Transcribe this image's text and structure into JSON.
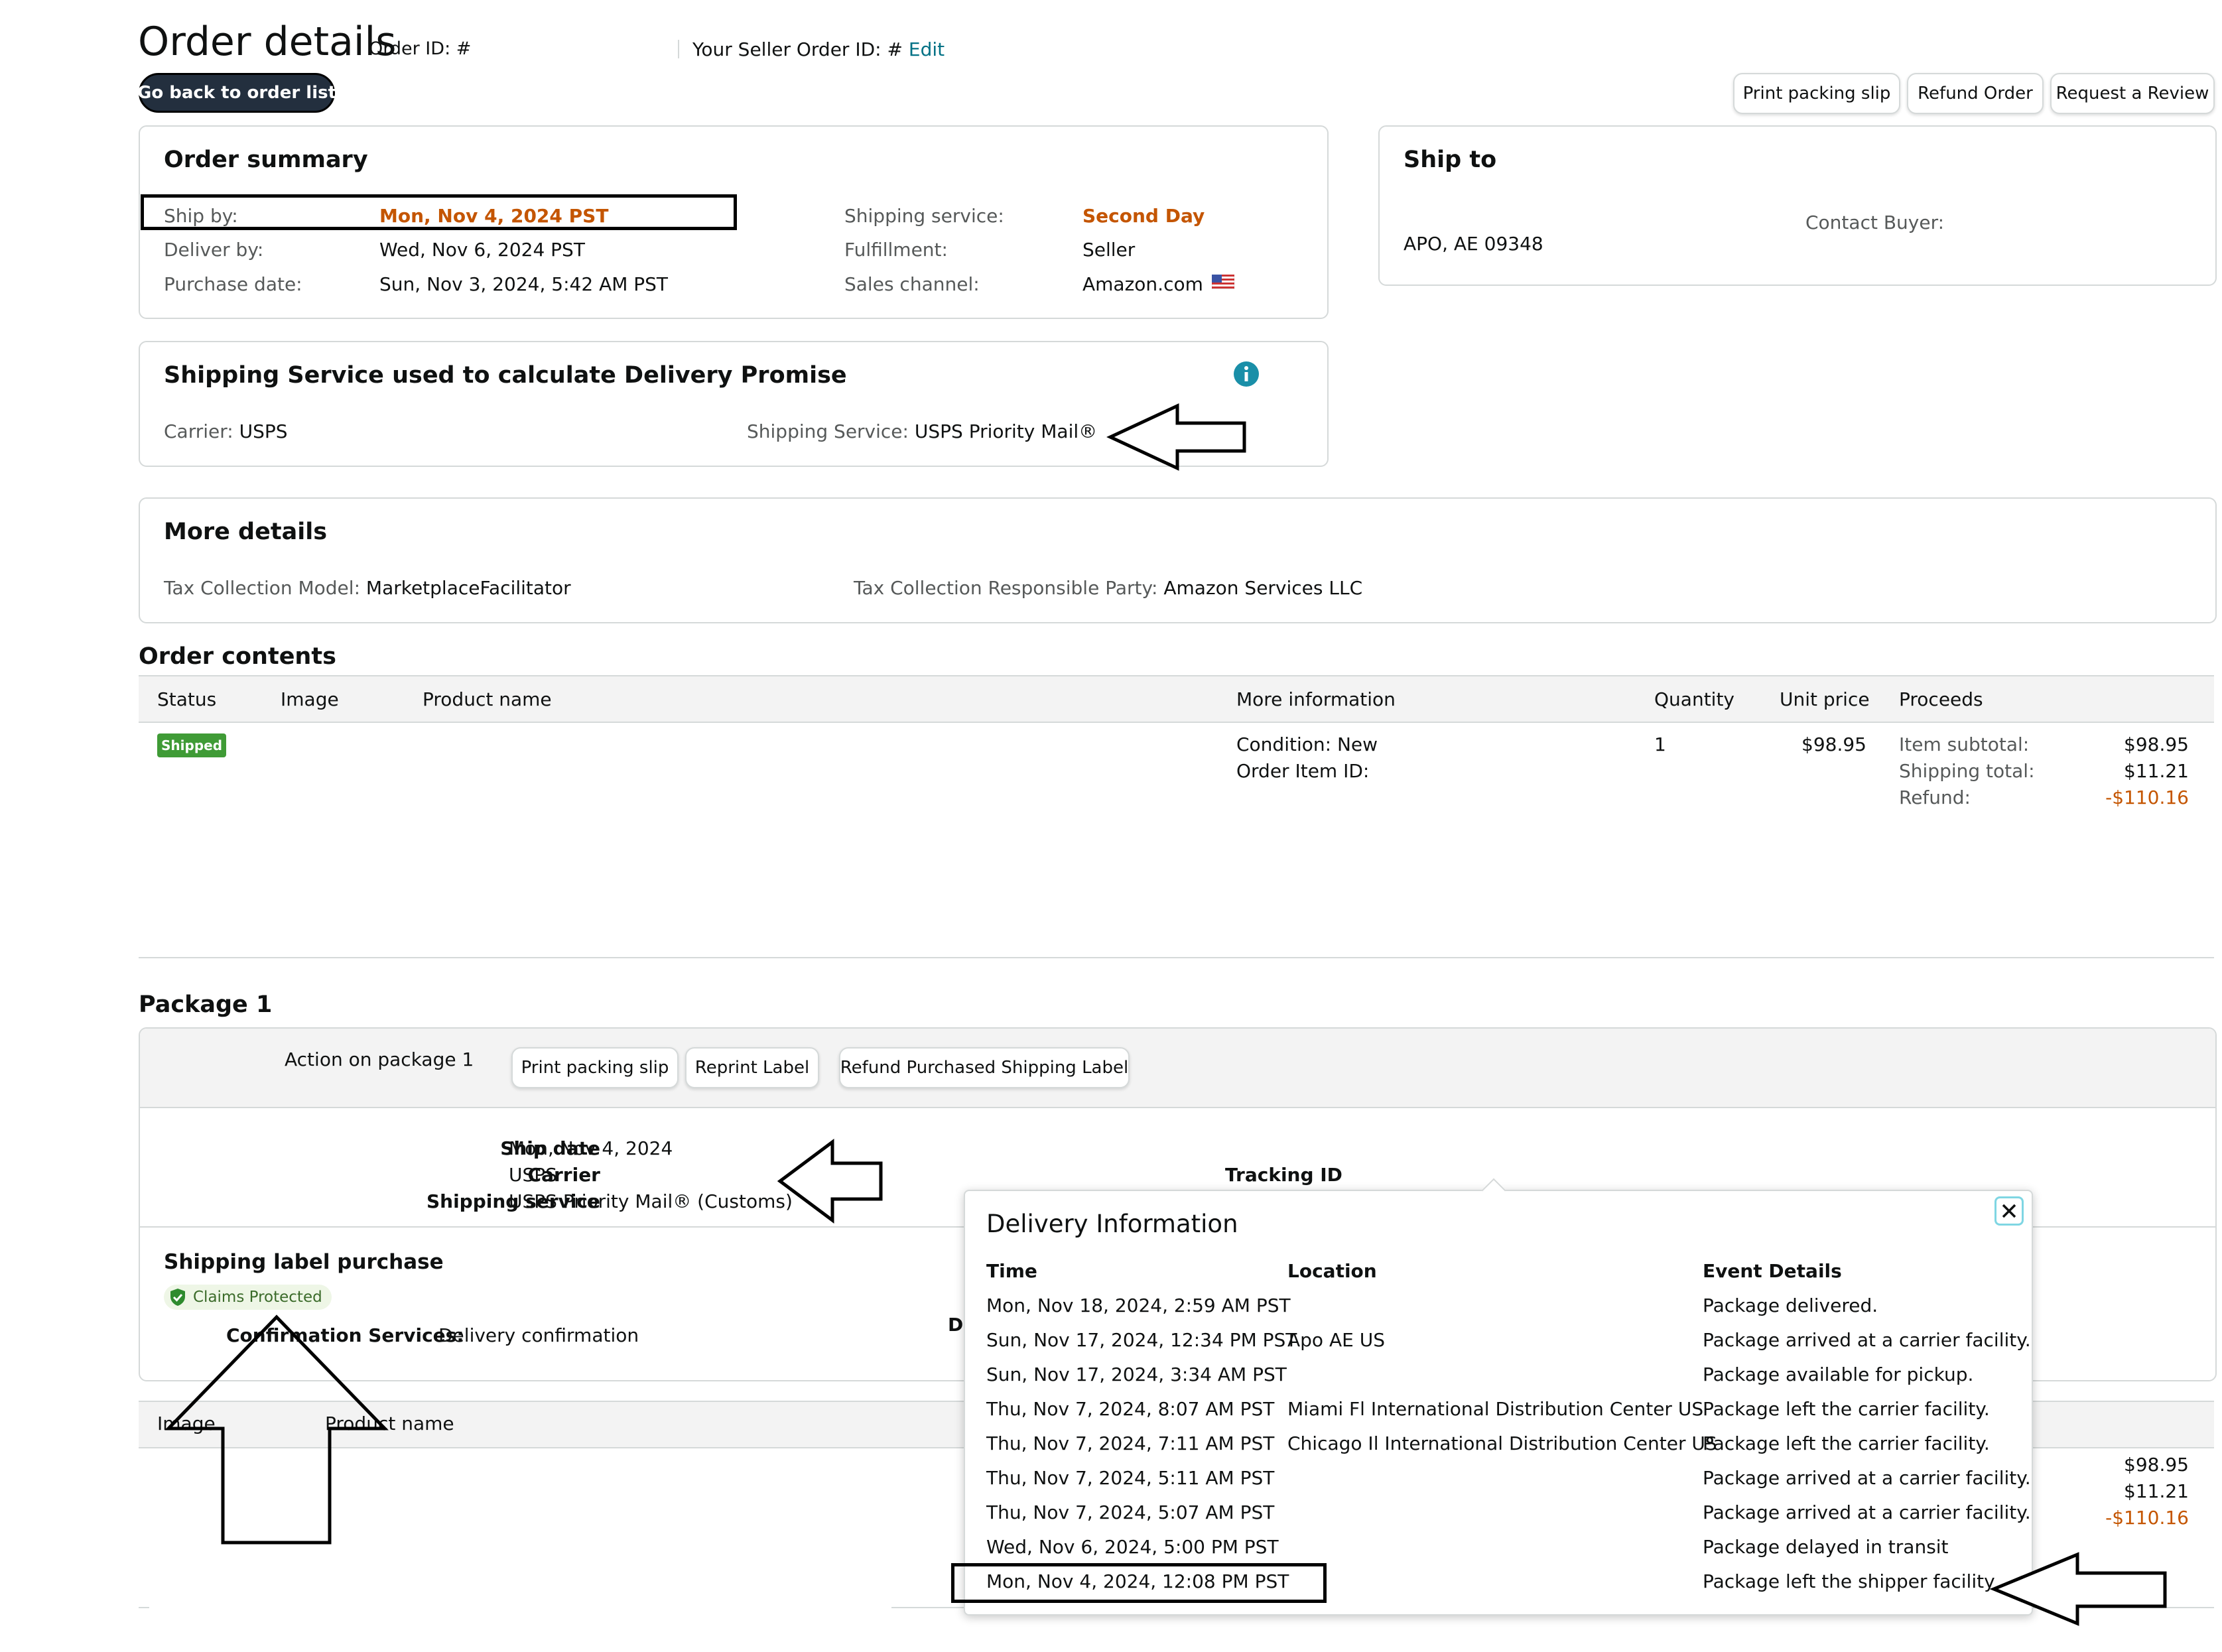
{
  "header": {
    "title": "Order details",
    "order_id_label": "Order ID: #",
    "seller_order_id_label": "Your Seller Order ID: #",
    "edit_link": "Edit",
    "back_button": "Go back to order list",
    "actions": [
      "Print packing slip",
      "Refund Order",
      "Request a Review"
    ]
  },
  "order_summary": {
    "title": "Order summary",
    "ship_by_label": "Ship by:",
    "ship_by_value": "Mon, Nov 4, 2024 PST",
    "deliver_by_label": "Deliver by:",
    "deliver_by_value": "Wed, Nov 6, 2024 PST",
    "purchase_date_label": "Purchase date:",
    "purchase_date_value": "Sun, Nov 3, 2024, 5:42 AM PST",
    "shipping_service_label": "Shipping service:",
    "shipping_service_value": "Second Day",
    "fulfillment_label": "Fulfillment:",
    "fulfillment_value": "Seller",
    "sales_channel_label": "Sales channel:",
    "sales_channel_value": "Amazon.com"
  },
  "ship_to": {
    "title": "Ship to",
    "address": "APO, AE 09348",
    "contact_buyer": "Contact Buyer:"
  },
  "delivery_promise": {
    "title": "Shipping Service used to calculate Delivery Promise",
    "carrier_label": "Carrier:",
    "carrier_value": "USPS",
    "service_label": "Shipping Service:",
    "service_value": "USPS Priority Mail®"
  },
  "more_details": {
    "title": "More details",
    "tax_model_label": "Tax Collection Model:",
    "tax_model_value": "MarketplaceFacilitator",
    "tax_party_label": "Tax Collection Responsible Party:",
    "tax_party_value": "Amazon Services LLC"
  },
  "order_contents": {
    "title": "Order contents",
    "columns": [
      "Status",
      "Image",
      "Product name",
      "More information",
      "Quantity",
      "Unit price",
      "Proceeds"
    ],
    "row": {
      "status": "Shipped",
      "condition": "Condition: New",
      "order_item_id": "Order Item ID:",
      "quantity": "1",
      "unit_price": "$98.95",
      "item_subtotal_label": "Item subtotal:",
      "item_subtotal": "$98.95",
      "shipping_total_label": "Shipping total:",
      "shipping_total": "$11.21",
      "refund_label": "Refund:",
      "refund": "-$110.16"
    }
  },
  "package": {
    "title": "Package 1",
    "action_label": "Action on package 1",
    "buttons": [
      "Print packing slip",
      "Reprint Label",
      "Refund Purchased Shipping Label"
    ],
    "ship_date_label": "Ship date",
    "ship_date_value": "Mon, Nov 4, 2024",
    "carrier_label": "Carrier",
    "carrier_value": "USPS",
    "service_label": "Shipping service",
    "service_value": "USPS Priority Mail® (Customs)",
    "tracking_label": "Tracking ID",
    "label_purchase_title": "Shipping label purchase",
    "claims_badge": "Claims Protected",
    "confirmation_label": "Confirmation Services:",
    "confirmation_value": "Delivery confirmation",
    "partial_text": "Di",
    "table_columns": [
      "Image",
      "Product name"
    ],
    "totals": [
      "$98.95",
      "$11.21",
      "-$110.16"
    ]
  },
  "delivery_info": {
    "title": "Delivery Information",
    "columns": [
      "Time",
      "Location",
      "Event Details"
    ],
    "events": [
      {
        "time": "Mon, Nov 18, 2024, 2:59 AM PST",
        "location": "",
        "event": "Package delivered."
      },
      {
        "time": "Sun, Nov 17, 2024, 12:34 PM PST",
        "location": "Apo AE US",
        "event": "Package arrived at a carrier facility."
      },
      {
        "time": "Sun, Nov 17, 2024, 3:34 AM PST",
        "location": "",
        "event": "Package available for pickup."
      },
      {
        "time": "Thu, Nov 7, 2024, 8:07 AM PST",
        "location": "Miami Fl International Distribution Center US",
        "event": "Package left the carrier facility."
      },
      {
        "time": "Thu, Nov 7, 2024, 7:11 AM PST",
        "location": "Chicago Il International Distribution Center US",
        "event": "Package left the carrier facility."
      },
      {
        "time": "Thu, Nov 7, 2024, 5:11 AM PST",
        "location": "",
        "event": "Package arrived at a carrier facility."
      },
      {
        "time": "Thu, Nov 7, 2024, 5:07 AM PST",
        "location": "",
        "event": "Package arrived at a carrier facility."
      },
      {
        "time": "Wed, Nov 6, 2024, 5:00 PM PST",
        "location": "",
        "event": "Package delayed in transit"
      },
      {
        "time": "Mon, Nov 4, 2024, 12:08 PM PST",
        "location": "",
        "event": "Package left the shipper facility"
      }
    ]
  },
  "colors": {
    "orange": "#c45500",
    "link": "#007185",
    "shipped_badge": "#3f9b36",
    "info_icon": "#1a8fa8"
  },
  "icons": [
    "info-icon",
    "us-flag-icon",
    "close-icon",
    "shield-check-icon"
  ]
}
